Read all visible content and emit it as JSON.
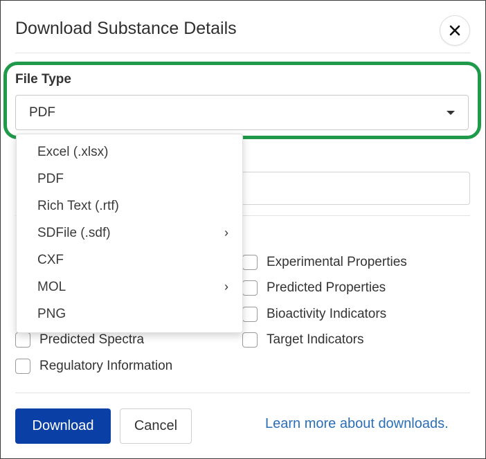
{
  "dialog": {
    "title": "Download Substance Details",
    "close_icon": "close-icon"
  },
  "file_type": {
    "label": "File Type",
    "selected": "PDF",
    "highlight_color": "#1f9a4a",
    "options": [
      {
        "label": "Excel (.xlsx)",
        "has_submenu": false
      },
      {
        "label": "PDF",
        "has_submenu": false
      },
      {
        "label": "Rich Text (.rtf)",
        "has_submenu": false
      },
      {
        "label": "SDFile (.sdf)",
        "has_submenu": true
      },
      {
        "label": "CXF",
        "has_submenu": false
      },
      {
        "label": "MOL",
        "has_submenu": true
      },
      {
        "label": "PNG",
        "has_submenu": false
      }
    ],
    "submenu_glyph": "›"
  },
  "checkboxes": {
    "right": [
      {
        "label": "Experimental Properties",
        "checked": false
      },
      {
        "label": "Predicted Properties",
        "checked": false
      },
      {
        "label": "Bioactivity Indicators",
        "checked": false
      },
      {
        "label": "Target Indicators",
        "checked": false
      }
    ],
    "left": [
      {
        "label": "Predicted Spectra",
        "checked": false
      },
      {
        "label": "Regulatory Information",
        "checked": false
      }
    ]
  },
  "footer": {
    "download_label": "Download",
    "cancel_label": "Cancel",
    "learn_more_label": "Learn more about downloads.",
    "primary_color": "#0a3fa6",
    "link_color": "#2a6eb8"
  }
}
